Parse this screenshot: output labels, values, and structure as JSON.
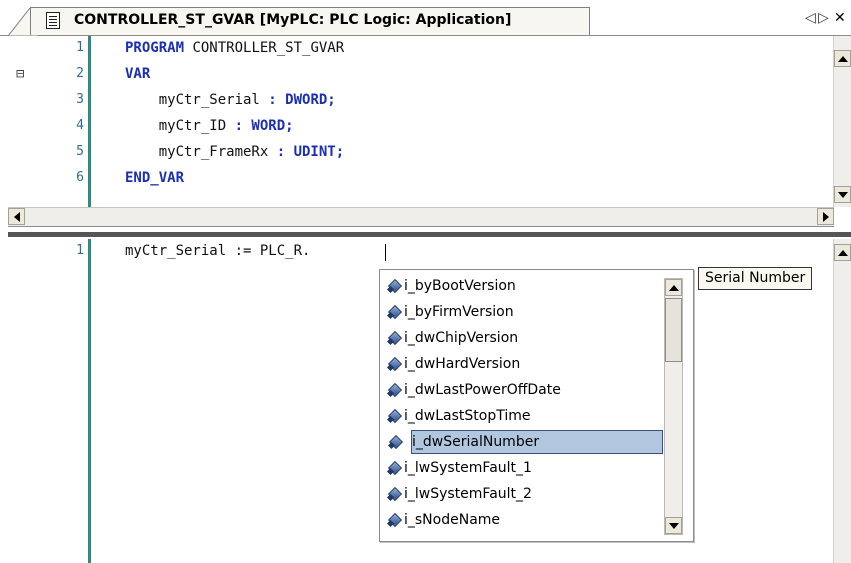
{
  "tab": {
    "title": "CONTROLLER_ST_GVAR [MyPLC: PLC Logic: Application]",
    "nav_prev": "◁",
    "nav_next": "▷",
    "close": "✕"
  },
  "declaration_editor": {
    "lines": [
      {
        "number": "1",
        "parts": [
          {
            "text": "PROGRAM",
            "kw": true
          },
          {
            "text": " CONTROLLER_ST_GVAR",
            "kw": false
          }
        ]
      },
      {
        "number": "2",
        "parts": [
          {
            "text": "VAR",
            "kw": true
          }
        ],
        "collapse": "⊟"
      },
      {
        "number": "3",
        "parts": [
          {
            "text": "    myCtr_Serial ",
            "kw": false
          },
          {
            "text": ": DWORD;",
            "kw": true
          }
        ]
      },
      {
        "number": "4",
        "parts": [
          {
            "text": "    myCtr_ID ",
            "kw": false
          },
          {
            "text": ": WORD;",
            "kw": true
          }
        ]
      },
      {
        "number": "5",
        "parts": [
          {
            "text": "    myCtr_FrameRx ",
            "kw": false
          },
          {
            "text": ": UDINT;",
            "kw": true
          }
        ]
      },
      {
        "number": "6",
        "parts": [
          {
            "text": "END_VAR",
            "kw": true
          }
        ]
      }
    ]
  },
  "implementation_editor": {
    "lines": [
      {
        "number": "1",
        "text": "myCtr_Serial := PLC_R."
      }
    ]
  },
  "autocomplete": {
    "items": [
      "i_byBootVersion",
      "i_byFirmVersion",
      "i_dwChipVersion",
      "i_dwHardVersion",
      "i_dwLastPowerOffDate",
      "i_dwLastStopTime",
      "i_dwSerialNumber",
      "i_lwSystemFault_1",
      "i_lwSystemFault_2",
      "i_sNodeName"
    ],
    "selected_index": 6,
    "tooltip": "Serial Number"
  },
  "colors": {
    "keyword": "#1b2fb5",
    "line_number": "#2e6f8e",
    "selection": "#b0c7df"
  }
}
